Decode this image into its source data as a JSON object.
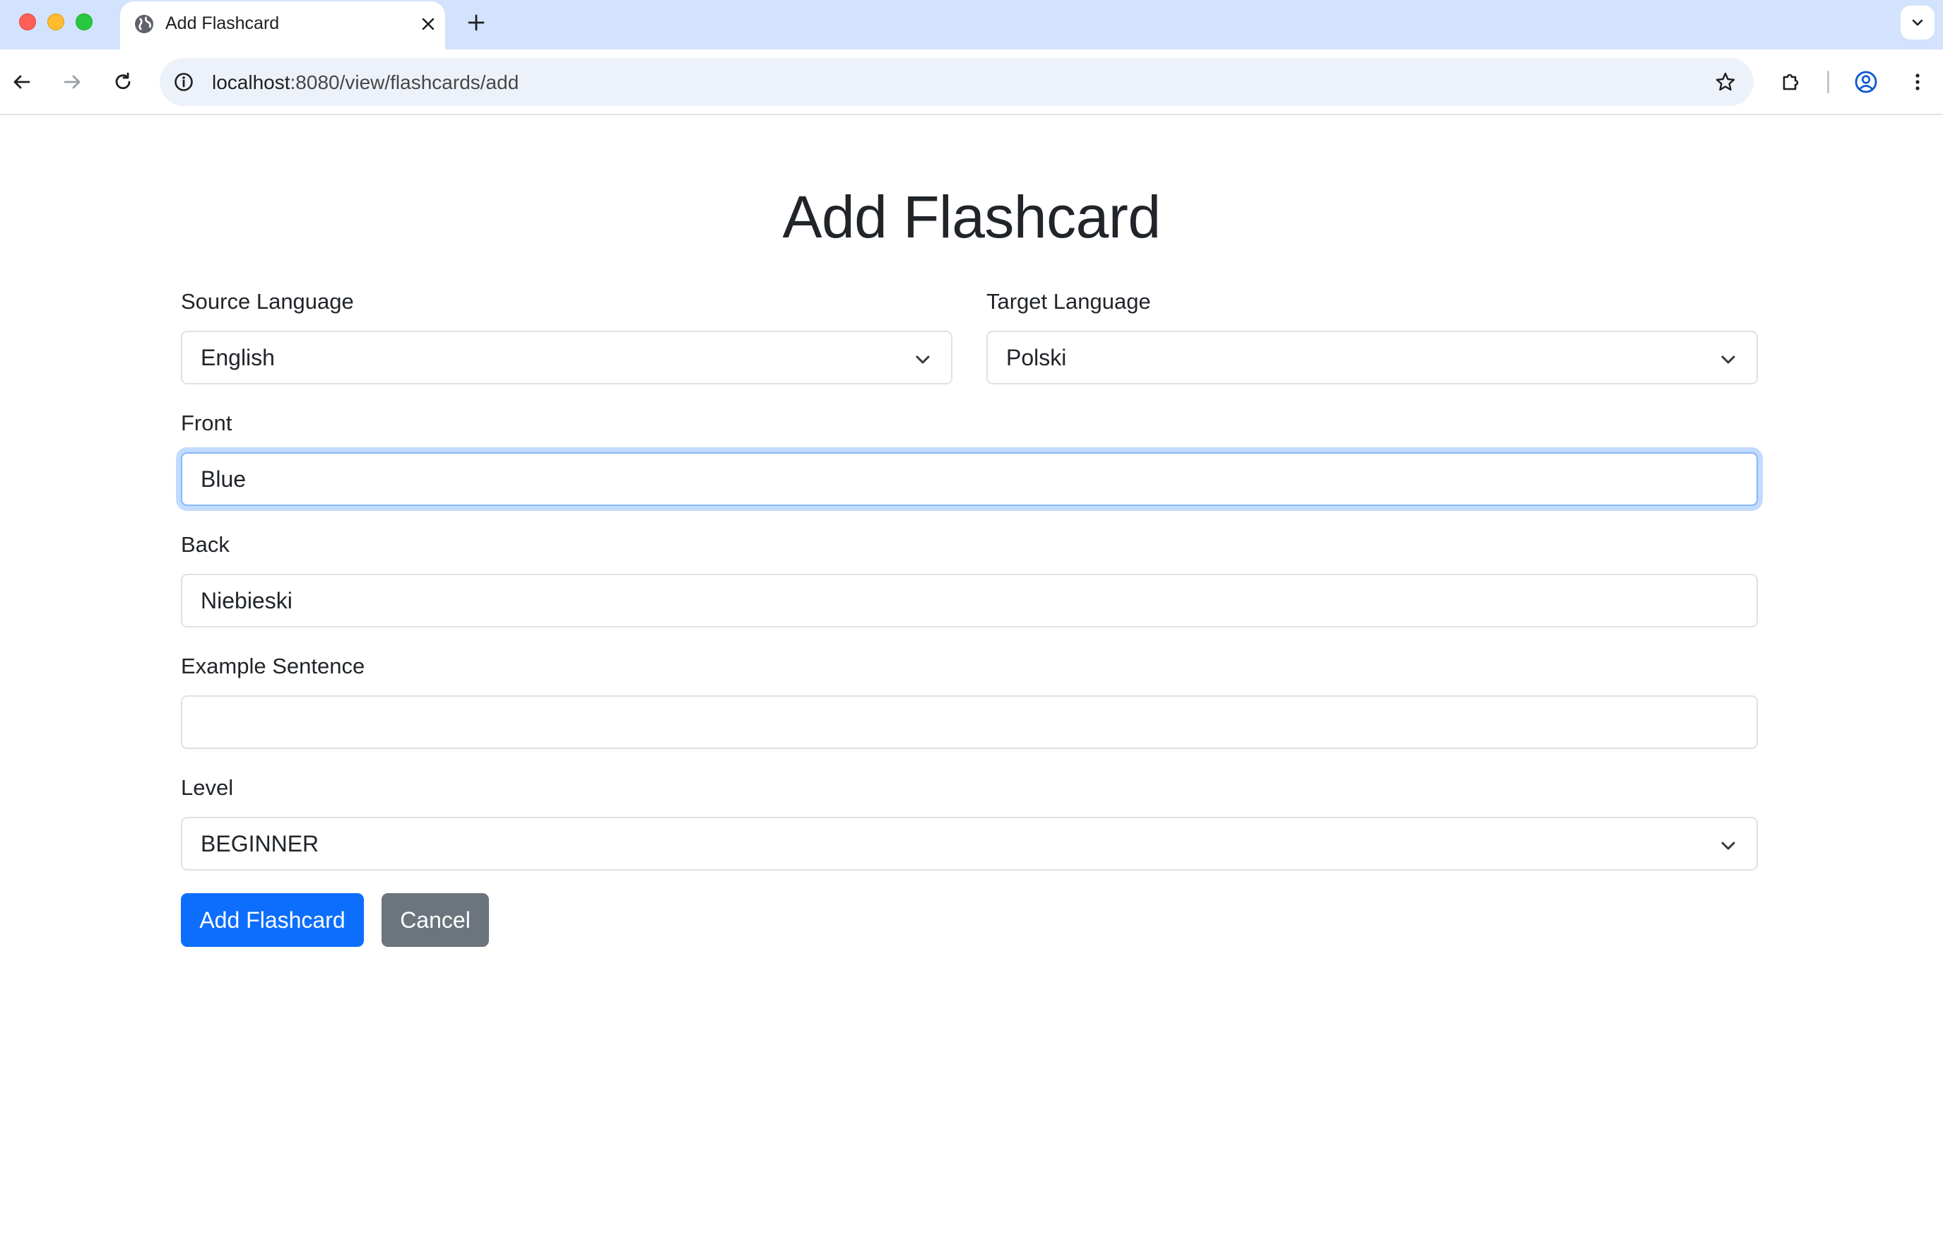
{
  "browser": {
    "tab_title": "Add Flashcard",
    "url_host": "localhost",
    "url_path": ":8080/view/flashcards/add",
    "icons": {
      "back": "arrow-left-icon",
      "forward": "arrow-right-icon",
      "reload": "reload-icon",
      "site_info": "info-icon",
      "bookmark": "star-icon",
      "extensions": "puzzle-icon",
      "profile": "account-circle-icon",
      "menu": "kebab-menu-icon",
      "new_tab": "plus-icon",
      "tab_search": "chevron-down-icon",
      "favicon": "globe-icon",
      "close_tab": "close-icon"
    }
  },
  "page": {
    "title": "Add Flashcard",
    "source_language": {
      "label": "Source Language",
      "value": "English"
    },
    "target_language": {
      "label": "Target Language",
      "value": "Polski"
    },
    "front": {
      "label": "Front",
      "value": "Blue"
    },
    "back": {
      "label": "Back",
      "value": "Niebieski"
    },
    "example_sentence": {
      "label": "Example Sentence",
      "value": ""
    },
    "level": {
      "label": "Level",
      "value": "BEGINNER"
    },
    "submit_label": "Add Flashcard",
    "cancel_label": "Cancel"
  },
  "colors": {
    "primary": "#0d6efd",
    "secondary": "#6c757d",
    "focus_ring": "#86b7fe",
    "tabstrip": "#d3e3fd"
  }
}
